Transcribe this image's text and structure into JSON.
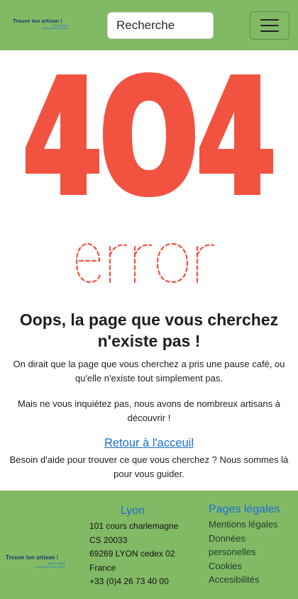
{
  "header": {
    "logo": {
      "title": "Trouve ton artisan !",
      "tagline1": "Avec la région",
      "tagline2": "Auvergne-Rhône-Alpes"
    },
    "search": {
      "placeholder": "Recherche"
    },
    "menu_icon": "hamburger-menu-icon"
  },
  "illustration": {
    "code": "404",
    "word": "error",
    "color": "#f25340"
  },
  "main": {
    "title": "Oops, la page que vous cherchez n'existe pas !",
    "paragraph1": "On dirait que la page que vous cherchez a pris une pause café, ou qu'elle n'existe tout simplement pas.",
    "paragraph2": "Mais ne vous inquiétez pas, nous avons de nombreux artisans à découvrir !",
    "back_link": "Retour à l'acceuil",
    "paragraph3": "Besoin d'aide pour trouver ce que vous cherchez ? Nous sommes là pour vous guider."
  },
  "footer": {
    "logo": {
      "title": "Trouve ton artisan !",
      "tagline1": "Avec la région",
      "tagline2": "Auvergne-Rhône-Alpes"
    },
    "address_title": "Lyon",
    "address_lines": [
      "101 cours charlemagne",
      "CS 20033",
      "69269 LYON cedex 02",
      "France",
      "+33 (0)4 26 73 40 00"
    ],
    "legal_title": "Pages légales",
    "legal_links": [
      "Mentions légales",
      "Données personelles",
      "Cookies",
      "Accesibilités"
    ]
  },
  "colors": {
    "brand_green": "#82b965",
    "link_blue": "#1d6fd1",
    "error_red": "#f25340"
  }
}
